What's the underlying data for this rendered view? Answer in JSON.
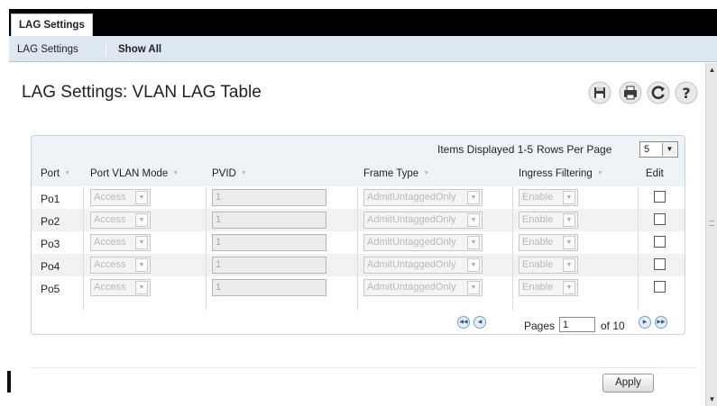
{
  "top_tab": {
    "label": "LAG Settings"
  },
  "subnav": {
    "items": [
      "LAG Settings",
      "Show All"
    ]
  },
  "page": {
    "title": "LAG Settings: VLAN LAG Table"
  },
  "toolbar": {
    "icons": [
      "save-icon",
      "print-icon",
      "refresh-icon",
      "help-icon"
    ]
  },
  "table": {
    "items_displayed": "Items Displayed 1-5",
    "rows_per_page_label": "Rows Per Page",
    "rows_per_page_value": "5",
    "columns": [
      "Port",
      "Port VLAN Mode",
      "PVID",
      "Frame Type",
      "Ingress Filtering",
      "Edit"
    ],
    "rows": [
      {
        "port": "Po1",
        "mode": "Access",
        "pvid": "1",
        "frame_type": "AdmitUntaggedOnly",
        "ingress": "Enable"
      },
      {
        "port": "Po2",
        "mode": "Access",
        "pvid": "1",
        "frame_type": "AdmitUntaggedOnly",
        "ingress": "Enable"
      },
      {
        "port": "Po3",
        "mode": "Access",
        "pvid": "1",
        "frame_type": "AdmitUntaggedOnly",
        "ingress": "Enable"
      },
      {
        "port": "Po4",
        "mode": "Access",
        "pvid": "1",
        "frame_type": "AdmitUntaggedOnly",
        "ingress": "Enable"
      },
      {
        "port": "Po5",
        "mode": "Access",
        "pvid": "1",
        "frame_type": "AdmitUntaggedOnly",
        "ingress": "Enable"
      }
    ]
  },
  "pager": {
    "pages_label": "Pages",
    "current_page": "1",
    "of_label": "of 10"
  },
  "footer": {
    "apply_label": "Apply"
  },
  "colors": {
    "nav_bar": "#000000",
    "subnav_bg": "#dce7f2",
    "panel_head": "#eef3f8"
  }
}
